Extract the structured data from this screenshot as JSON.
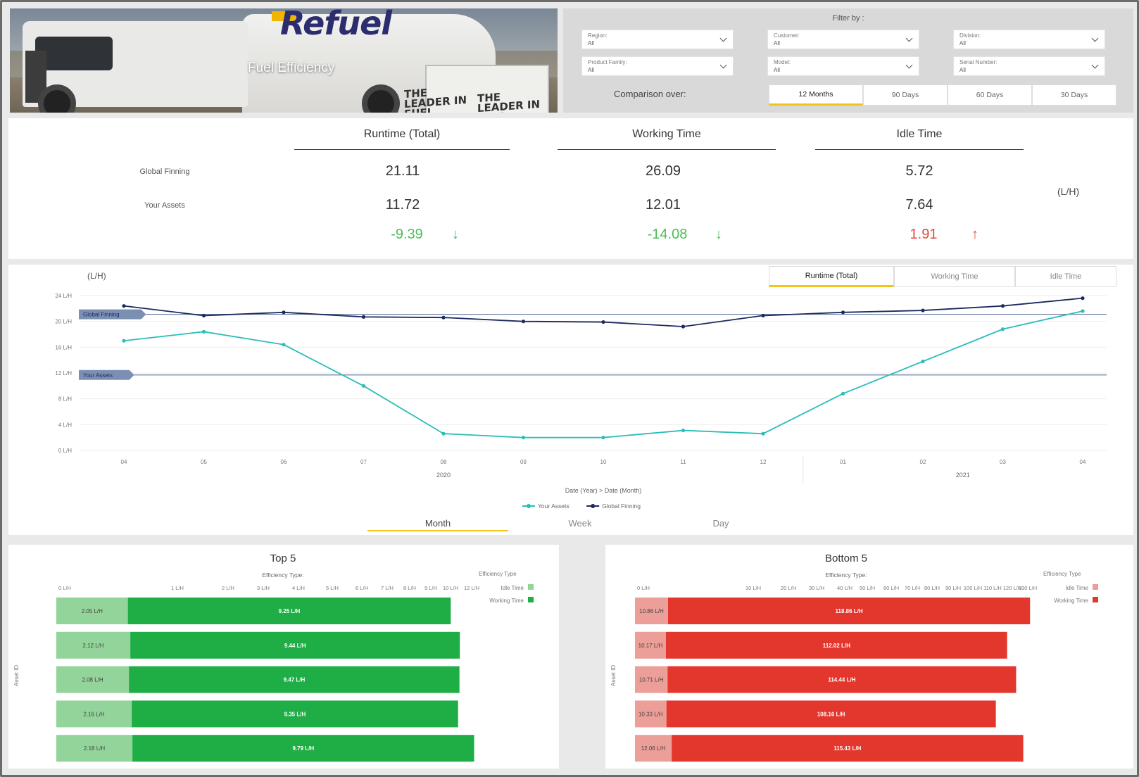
{
  "header": {
    "title": "Fuel Efficiency",
    "logo_text": "Refuel",
    "slogan_1": "THE LEADER IN FUEL MANAGEMENT",
    "slogan_2": "THE LEADER IN FUEL MANAGEMENT"
  },
  "filters": {
    "label": "Filter by :",
    "dropdowns": [
      {
        "label": "Region:",
        "value": "All"
      },
      {
        "label": "Customer:",
        "value": "All"
      },
      {
        "label": "Division:",
        "value": "All"
      },
      {
        "label": "Product Family:",
        "value": "All"
      },
      {
        "label": "Model:",
        "value": "All"
      },
      {
        "label": "Serial Number:",
        "value": "All"
      }
    ],
    "comparison_label": "Comparison over:",
    "comparison_tabs": [
      "12 Months",
      "90 Days",
      "60 Days",
      "30 Days"
    ],
    "comparison_active": "12 Months"
  },
  "kpi": {
    "columns": [
      "Runtime (Total)",
      "Working Time",
      "Idle Time"
    ],
    "rows": [
      "Global Finning",
      "Your Assets"
    ],
    "global": [
      "21.11",
      "26.09",
      "5.72"
    ],
    "yours": [
      "11.72",
      "12.01",
      "7.64"
    ],
    "deltas": [
      "-9.39",
      "-14.08",
      "1.91"
    ],
    "delta_status": [
      "good",
      "good",
      "bad"
    ],
    "unit": "(L/H)"
  },
  "trend": {
    "tabs": [
      "Runtime (Total)",
      "Working Time",
      "Idle Time"
    ],
    "tab_active": "Runtime (Total)",
    "granularity": [
      "Month",
      "Week",
      "Day"
    ],
    "granularity_active": "Month"
  },
  "chart_data": [
    {
      "type": "line",
      "ylabel": "(L/H)",
      "xlabel": "Date (Year) > Date (Month)",
      "x": [
        "04",
        "05",
        "06",
        "07",
        "08",
        "09",
        "10",
        "11",
        "12",
        "01",
        "02",
        "03",
        "04"
      ],
      "x_groups": [
        {
          "label": "2020",
          "months": [
            "04",
            "05",
            "06",
            "07",
            "08",
            "09",
            "10",
            "11",
            "12"
          ]
        },
        {
          "label": "2021",
          "months": [
            "01",
            "02",
            "03",
            "04"
          ]
        }
      ],
      "yticks": [
        "0 L/H",
        "4 L/H",
        "8 L/H",
        "12 L/H",
        "16 L/H",
        "20 L/H",
        "24 L/H"
      ],
      "ylim": [
        0,
        24
      ],
      "series": [
        {
          "name": "Your Assets",
          "color": "#2bbdb8",
          "values": [
            17.0,
            18.4,
            16.4,
            10.0,
            2.6,
            2.0,
            2.0,
            3.1,
            2.6,
            8.8,
            13.8,
            18.8,
            21.6
          ]
        },
        {
          "name": "Global Finning",
          "color": "#1c2a5c",
          "values": [
            22.4,
            20.9,
            21.4,
            20.7,
            20.6,
            20.0,
            19.9,
            19.2,
            20.9,
            21.4,
            21.7,
            22.4,
            23.6
          ]
        }
      ],
      "reference_lines": [
        {
          "label": "Global Finning",
          "value": 21.1
        },
        {
          "label": "Your Assets",
          "value": 11.7
        }
      ],
      "legend": "bottom"
    },
    {
      "type": "bar",
      "title": "Top 5",
      "subtitle": "Efficiency Type:",
      "ylabel": "Asset ID",
      "legend_title": "Efficiency Type",
      "stacked": true,
      "orientation": "horizontal",
      "xticks": [
        "0 L/H",
        "1 L/H",
        "2 L/H",
        "3 L/H",
        "4 L/H",
        "5 L/H",
        "6 L/H",
        "7 L/H",
        "8 L/H",
        "9 L/H",
        "10 L/H",
        "12 L/H"
      ],
      "categories": [
        "",
        "",
        "",
        "",
        ""
      ],
      "series": [
        {
          "name": "Idle Time",
          "color": "#93d49a",
          "values": [
            2.05,
            2.12,
            2.08,
            2.16,
            2.18
          ],
          "labels": [
            "2.05 L/H",
            "2.12 L/H",
            "2.08 L/H",
            "2.16 L/H",
            "2.18 L/H"
          ]
        },
        {
          "name": "Working Time",
          "color": "#1fae45",
          "values": [
            9.25,
            9.44,
            9.47,
            9.35,
            9.79
          ],
          "labels": [
            "9.25 L/H",
            "9.44 L/H",
            "9.47 L/H",
            "9.35 L/H",
            "9.79 L/H"
          ]
        }
      ]
    },
    {
      "type": "bar",
      "title": "Bottom 5",
      "subtitle": "Efficiency Type:",
      "ylabel": "Asset ID",
      "legend_title": "Efficiency Type",
      "stacked": true,
      "orientation": "horizontal",
      "xticks": [
        "0 L/H",
        "10 L/H",
        "20 L/H",
        "30 L/H",
        "40 L/H",
        "50 L/H",
        "60 L/H",
        "70 L/H",
        "80 L/H",
        "90 L/H",
        "100 L/H",
        "110 L/H",
        "120 L/H",
        "130 L/H"
      ],
      "categories": [
        "",
        "",
        "",
        "",
        ""
      ],
      "series": [
        {
          "name": "Idle Time",
          "color": "#ec9e98",
          "values": [
            10.86,
            10.17,
            10.71,
            10.33,
            12.06
          ],
          "labels": [
            "10.86 L/H",
            "10.17 L/H",
            "10.71 L/H",
            "10.33 L/H",
            "12.06 L/H"
          ]
        },
        {
          "name": "Working Time",
          "color": "#e3362d",
          "values": [
            118.86,
            112.02,
            114.44,
            108.16,
            115.43
          ],
          "labels": [
            "118.86 L/H",
            "112.02 L/H",
            "114.44 L/H",
            "108.16 L/H",
            "115.43 L/H"
          ]
        }
      ]
    }
  ]
}
